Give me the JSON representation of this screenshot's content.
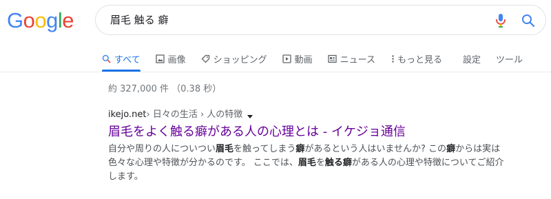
{
  "logo": {
    "letters": [
      {
        "ch": "G",
        "color": "#4285F4"
      },
      {
        "ch": "o",
        "color": "#EA4335"
      },
      {
        "ch": "o",
        "color": "#FBBC05"
      },
      {
        "ch": "g",
        "color": "#4285F4"
      },
      {
        "ch": "l",
        "color": "#34A853"
      },
      {
        "ch": "e",
        "color": "#EA4335"
      }
    ]
  },
  "search": {
    "query": "眉毛 触る 癖",
    "mic_icon": "microphone-icon",
    "search_icon": "search-icon"
  },
  "tabs": [
    {
      "label": "すべて",
      "icon": "search-icon",
      "active": true
    },
    {
      "label": "画像",
      "icon": "image-icon"
    },
    {
      "label": "ショッピング",
      "icon": "tag-icon"
    },
    {
      "label": "動画",
      "icon": "play-icon"
    },
    {
      "label": "ニュース",
      "icon": "news-icon"
    },
    {
      "label": "もっと見る",
      "icon": "more-vert-icon"
    },
    {
      "label": "設定"
    },
    {
      "label": "ツール"
    }
  ],
  "stats": "約 327,000 件 （0.38 秒）",
  "result": {
    "domain": "ikejo.net",
    "breadcrumb": " › 日々の生活 › 人の特徴",
    "title": "眉毛をよく触る癖がある人の心理とは - イケジョ通信",
    "snippet_parts": [
      {
        "text": "自分や周りの人についつい",
        "bold": false
      },
      {
        "text": "眉毛",
        "bold": true
      },
      {
        "text": "を触ってしまう",
        "bold": false
      },
      {
        "text": "癖",
        "bold": true
      },
      {
        "text": "があるという人はいませんか? この",
        "bold": false
      },
      {
        "text": "癖",
        "bold": true
      },
      {
        "text": "からは実は色々な心理や特徴が分かるのです。 ここでは、",
        "bold": false
      },
      {
        "text": "眉毛",
        "bold": true
      },
      {
        "text": "を",
        "bold": false
      },
      {
        "text": "触る",
        "bold": true
      },
      {
        "text": "癖",
        "bold": true
      },
      {
        "text": "がある人の心理や特徴についてご紹介します。",
        "bold": false
      }
    ]
  },
  "colors": {
    "accent": "#1a73e8",
    "visited_link": "#660099",
    "muted": "#70757a"
  }
}
